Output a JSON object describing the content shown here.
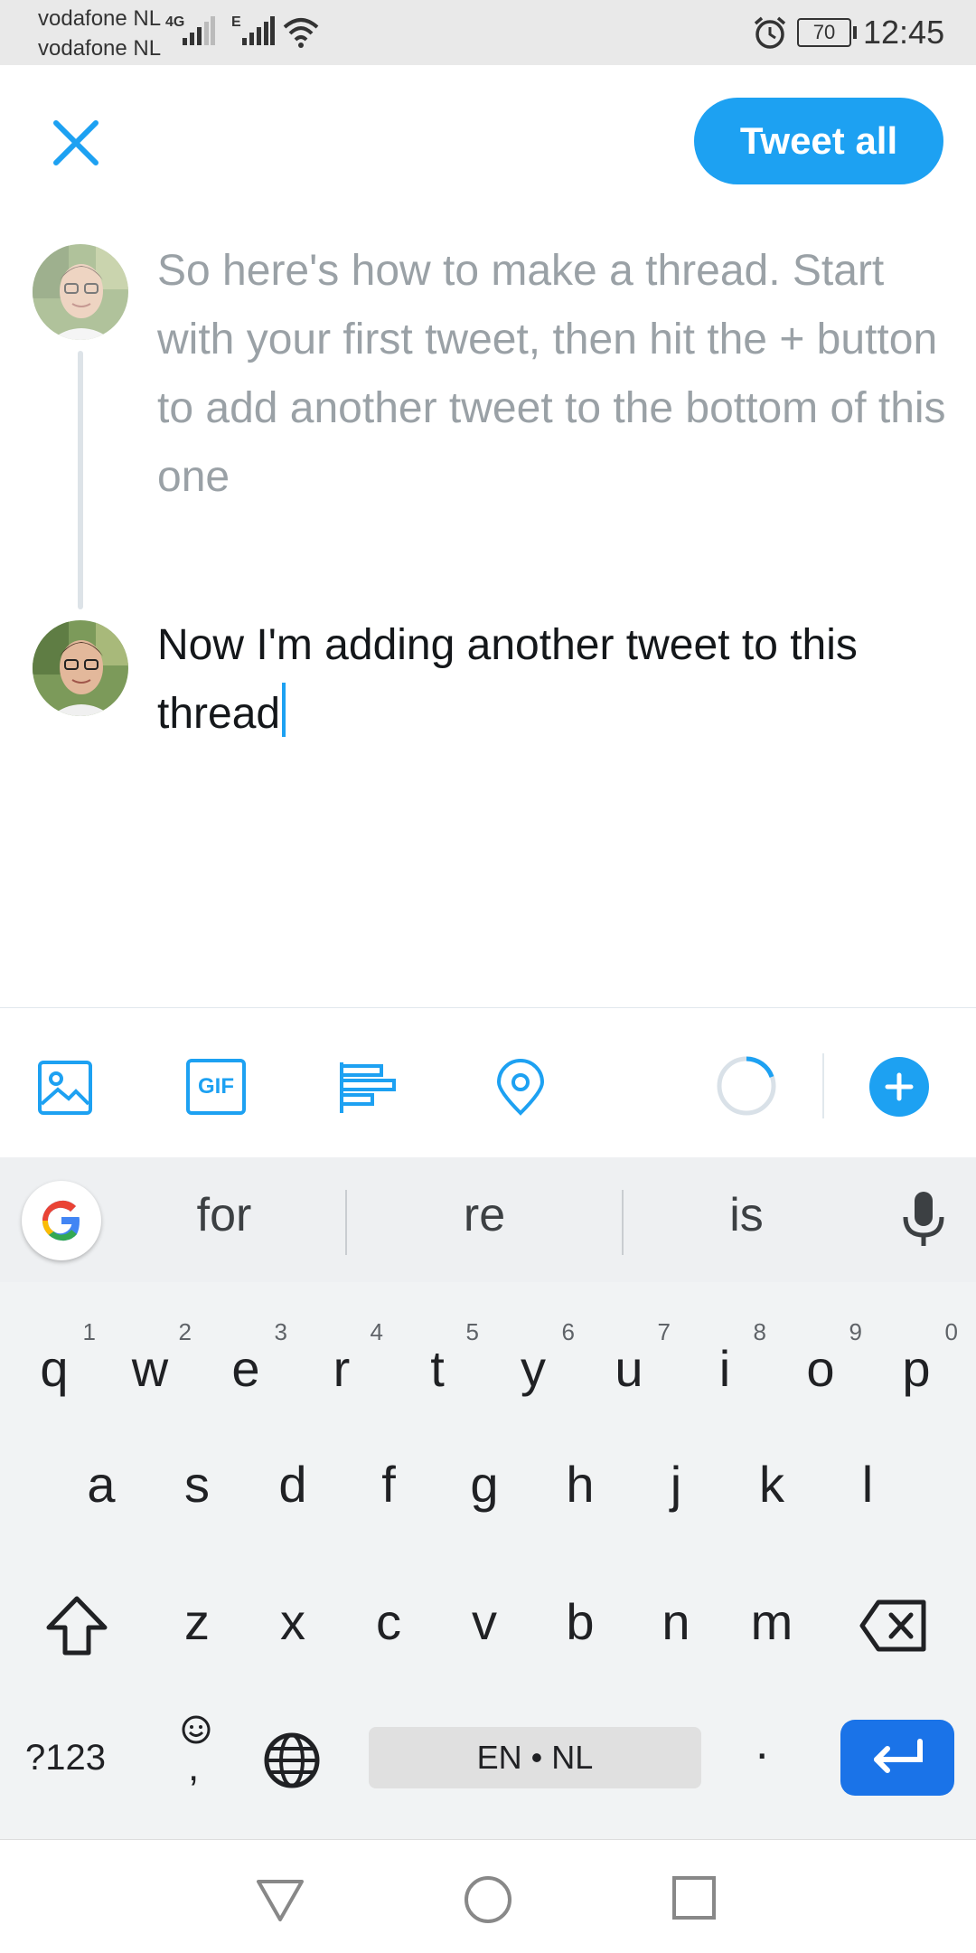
{
  "status_bar": {
    "carrier1": "vodafone NL",
    "carrier2": "vodafone NL",
    "network1": "4G",
    "network2": "E",
    "battery": "70",
    "time": "12:45"
  },
  "header": {
    "close_icon": "close-icon",
    "tweet_all_label": "Tweet all"
  },
  "thread": {
    "tweets": [
      {
        "text": "So here's how to make a thread. Start with your first tweet, then hit the + button to add another tweet to the bottom of this one"
      },
      {
        "text": "Now I'm adding another tweet to this thread"
      }
    ]
  },
  "toolbar": {
    "icons": [
      "image-icon",
      "gif-icon",
      "poll-icon",
      "location-icon",
      "character-count-ring",
      "add-tweet-icon"
    ],
    "gif_label": "GIF"
  },
  "suggestions": {
    "items": [
      "for",
      "re",
      "is"
    ]
  },
  "keyboard": {
    "row1": [
      {
        "key": "q",
        "num": "1"
      },
      {
        "key": "w",
        "num": "2"
      },
      {
        "key": "e",
        "num": "3"
      },
      {
        "key": "r",
        "num": "4"
      },
      {
        "key": "t",
        "num": "5"
      },
      {
        "key": "y",
        "num": "6"
      },
      {
        "key": "u",
        "num": "7"
      },
      {
        "key": "i",
        "num": "8"
      },
      {
        "key": "o",
        "num": "9"
      },
      {
        "key": "p",
        "num": "0"
      }
    ],
    "row2": [
      "a",
      "s",
      "d",
      "f",
      "g",
      "h",
      "j",
      "k",
      "l"
    ],
    "row3": [
      "z",
      "x",
      "c",
      "v",
      "b",
      "n",
      "m"
    ],
    "symbols_label": "?123",
    "comma_label": ",",
    "space_label": "EN • NL",
    "period_label": "."
  },
  "colors": {
    "accent": "#1da1f2",
    "keyboard_enter": "#1a73e8"
  }
}
